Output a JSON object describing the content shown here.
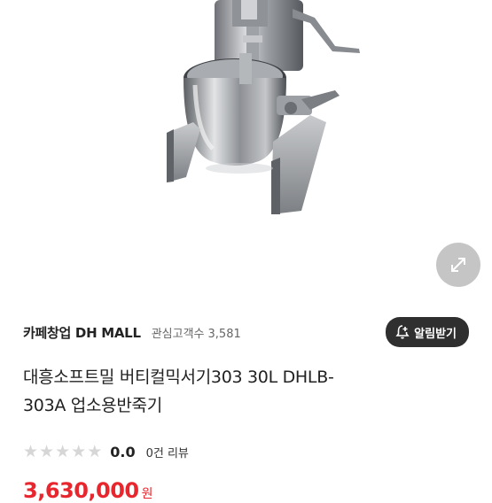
{
  "product": {
    "image_alt": "대흥소프트밀 버티컬믹서기 product photo",
    "expand_icon": "expand-arrows-icon"
  },
  "store": {
    "name": "카페창업 DH MALL",
    "followers_label": "관심고객수",
    "followers_count": "3,581",
    "notify_label": "알림받기",
    "notify_icon": "bell-plus-icon"
  },
  "title": {
    "line1": "대흥소프트밀 버티컬믹서기303 30L DHLB-",
    "line2": "303A 업소용반죽기"
  },
  "rating": {
    "stars_filled": 0,
    "stars_total": 5,
    "value": "0.0",
    "review_text": "0건 리뷰"
  },
  "price": {
    "amount": "3,630,000",
    "unit": "원"
  },
  "colors": {
    "price": "#e8262e",
    "notify_bg": "#2f2f2f",
    "star_empty": "#d6d6d6"
  }
}
